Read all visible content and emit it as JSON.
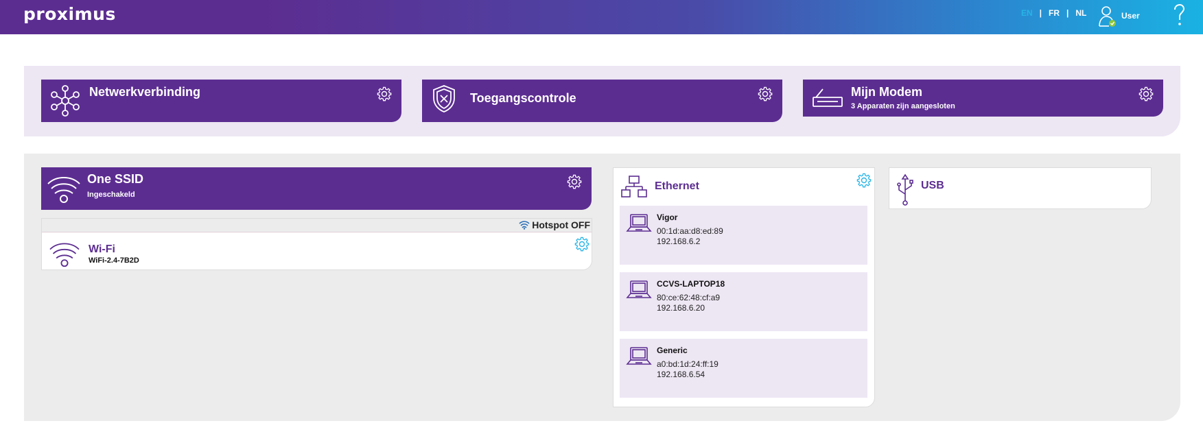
{
  "header": {
    "logo": "proximus",
    "languages": [
      "EN",
      "FR",
      "NL"
    ],
    "active_language": "EN",
    "user_label": "User",
    "help_icon": "question-mark-icon"
  },
  "top_tiles": {
    "network": {
      "title": "Netwerkverbinding",
      "icon": "network-nodes-icon"
    },
    "access": {
      "title": "Toegangscontrole",
      "icon": "shield-icon"
    },
    "modem": {
      "title": "Mijn Modem",
      "subtitle": "3 Apparaten zijn aangesloten",
      "icon": "modem-icon"
    }
  },
  "one_ssid": {
    "title": "One SSID",
    "subtitle": "Ingeschakeld",
    "icon": "wifi-icon"
  },
  "wifi": {
    "hotspot_label": "Hotspot OFF",
    "title": "Wi-Fi",
    "ssid": "WiFi-2.4-7B2D"
  },
  "ethernet": {
    "title": "Ethernet",
    "devices": [
      {
        "name": "Vigor",
        "mac": "00:1d:aa:d8:ed:89",
        "ip": "192.168.6.2"
      },
      {
        "name": "CCVS-LAPTOP18",
        "mac": "80:ce:62:48:cf:a9",
        "ip": "192.168.6.20"
      },
      {
        "name": "Generic",
        "mac": "a0:bd:1d:24:ff:19",
        "ip": "192.168.6.54"
      }
    ]
  },
  "usb": {
    "title": "USB"
  },
  "colors": {
    "brand_purple": "#5c2d91",
    "accent_cyan": "#27b4e6",
    "panel_lilac": "#ede6f3",
    "panel_grey": "#ececec"
  }
}
